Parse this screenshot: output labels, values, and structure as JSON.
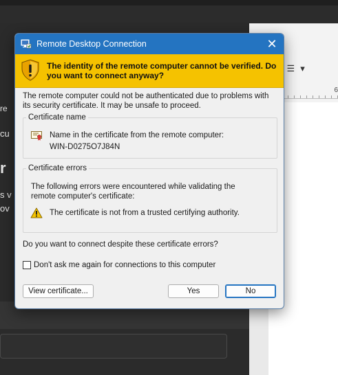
{
  "dialog": {
    "title": "Remote Desktop Connection",
    "close_glyph": "✕",
    "warning_heading": "The identity of the remote computer cannot be verified. Do you want to connect anyway?",
    "intro": "The remote computer could not be authenticated due to problems with its security certificate. It may be unsafe to proceed.",
    "certificate_name": {
      "legend": "Certificate name",
      "label": "Name in the certificate from the remote computer:",
      "value": "WIN-D0275O7J84N"
    },
    "certificate_errors": {
      "legend": "Certificate errors",
      "description": "The following errors were encountered while validating the remote computer's certificate:",
      "error": "The certificate is not from a trusted certifying authority."
    },
    "question": "Do you want to connect despite these certificate errors?",
    "dont_ask_label": "Don't ask me again for connections to this computer",
    "dont_ask_checked": false,
    "buttons": {
      "view_certificate": "View certificate...",
      "yes": "Yes",
      "no": "No"
    },
    "colors": {
      "titlebar": "#2474c1",
      "warning_banner": "#f5c200"
    }
  },
  "background": {
    "left_fragments": [
      "re",
      "cu",
      "r",
      "s v",
      "ov"
    ],
    "ruler_number": "6",
    "ribbon_glyphs": [
      "▾",
      "☰",
      "▾"
    ]
  }
}
